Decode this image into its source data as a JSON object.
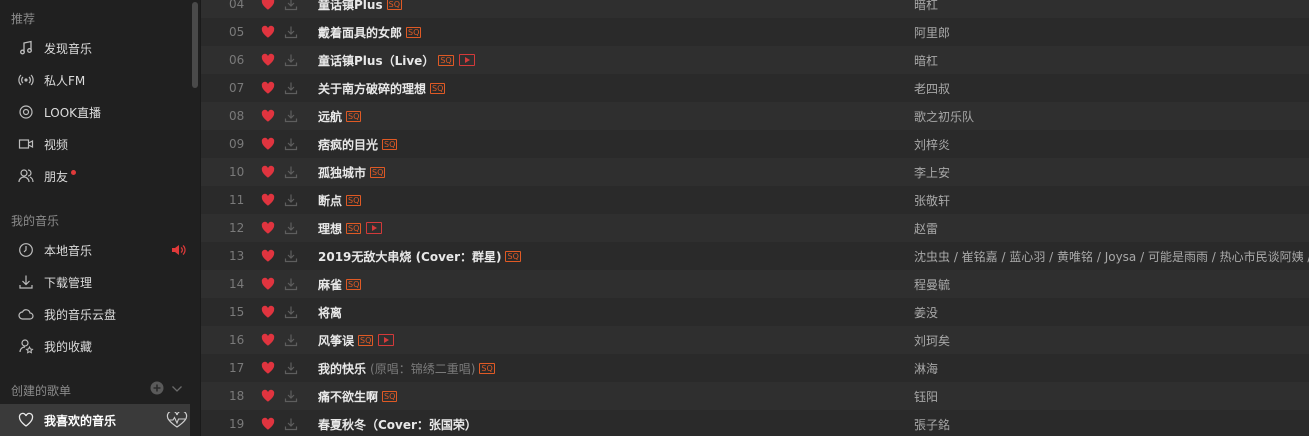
{
  "colors": {
    "accent": "#c62f2f",
    "sq": "#e05a25",
    "bg": "#2b2b2b",
    "sidebar": "#202020"
  },
  "sidebar": {
    "recommend_title": "推荐",
    "recommend": [
      {
        "label": "发现音乐",
        "icon": "music-note-icon"
      },
      {
        "label": "私人FM",
        "icon": "radio-icon"
      },
      {
        "label": "LOOK直播",
        "icon": "live-icon"
      },
      {
        "label": "视频",
        "icon": "video-icon"
      },
      {
        "label": "朋友",
        "icon": "friends-icon"
      }
    ],
    "mymusic_title": "我的音乐",
    "mymusic": [
      {
        "label": "本地音乐",
        "icon": "clock-icon"
      },
      {
        "label": "下载管理",
        "icon": "download-icon"
      },
      {
        "label": "我的音乐云盘",
        "icon": "cloud-icon"
      },
      {
        "label": "我的收藏",
        "icon": "collection-icon"
      }
    ],
    "created_title": "创建的歌单",
    "playlists": [
      {
        "label": "我喜欢的音乐",
        "icon": "heart-icon"
      }
    ]
  },
  "tracks": [
    {
      "num": "04",
      "title": "童话镇Plus",
      "sub": "",
      "sq": true,
      "mv": false,
      "artist": "暗杠"
    },
    {
      "num": "05",
      "title": "戴着面具的女郎",
      "sub": "",
      "sq": true,
      "mv": false,
      "artist": "阿里郎"
    },
    {
      "num": "06",
      "title": "童话镇Plus（Live）",
      "sub": "",
      "sq": true,
      "mv": true,
      "artist": "暗杠"
    },
    {
      "num": "07",
      "title": "关于南方破碎的理想",
      "sub": "",
      "sq": true,
      "mv": false,
      "artist": "老四叔"
    },
    {
      "num": "08",
      "title": "远航",
      "sub": "",
      "sq": true,
      "mv": false,
      "artist": "歌之初乐队"
    },
    {
      "num": "09",
      "title": "痞疯的目光",
      "sub": "",
      "sq": true,
      "mv": false,
      "artist": "刘梓炎"
    },
    {
      "num": "10",
      "title": "孤独城市",
      "sub": "",
      "sq": true,
      "mv": false,
      "artist": "李上安"
    },
    {
      "num": "11",
      "title": "断点",
      "sub": "",
      "sq": true,
      "mv": false,
      "artist": "张敬轩"
    },
    {
      "num": "12",
      "title": "理想",
      "sub": "",
      "sq": true,
      "mv": true,
      "artist": "赵雷"
    },
    {
      "num": "13",
      "title": "2019无敌大串烧 (Cover：群星)",
      "sub": "",
      "sq": true,
      "mv": false,
      "artist": "沈虫虫 / 崔铭嘉 / 蓝心羽 / 黄唯铭 / Joysa / 可能是雨雨 / 热心市民谈阿姨 / ..."
    },
    {
      "num": "14",
      "title": "麻雀",
      "sub": "",
      "sq": true,
      "mv": false,
      "artist": "程曼毓"
    },
    {
      "num": "15",
      "title": "将离",
      "sub": "",
      "sq": false,
      "mv": false,
      "artist": "姜没"
    },
    {
      "num": "16",
      "title": "风筝误",
      "sub": "",
      "sq": true,
      "mv": true,
      "artist": "刘珂矣"
    },
    {
      "num": "17",
      "title": "我的快乐",
      "sub": "(原唱：锦绣二重唱)",
      "sq": true,
      "mv": false,
      "artist": "淋海"
    },
    {
      "num": "18",
      "title": "痛不欲生啊",
      "sub": "",
      "sq": true,
      "mv": false,
      "artist": "钰阳"
    },
    {
      "num": "19",
      "title": "春夏秋冬（Cover：张国荣）",
      "sub": "",
      "sq": false,
      "mv": false,
      "artist": "張子銘"
    }
  ]
}
